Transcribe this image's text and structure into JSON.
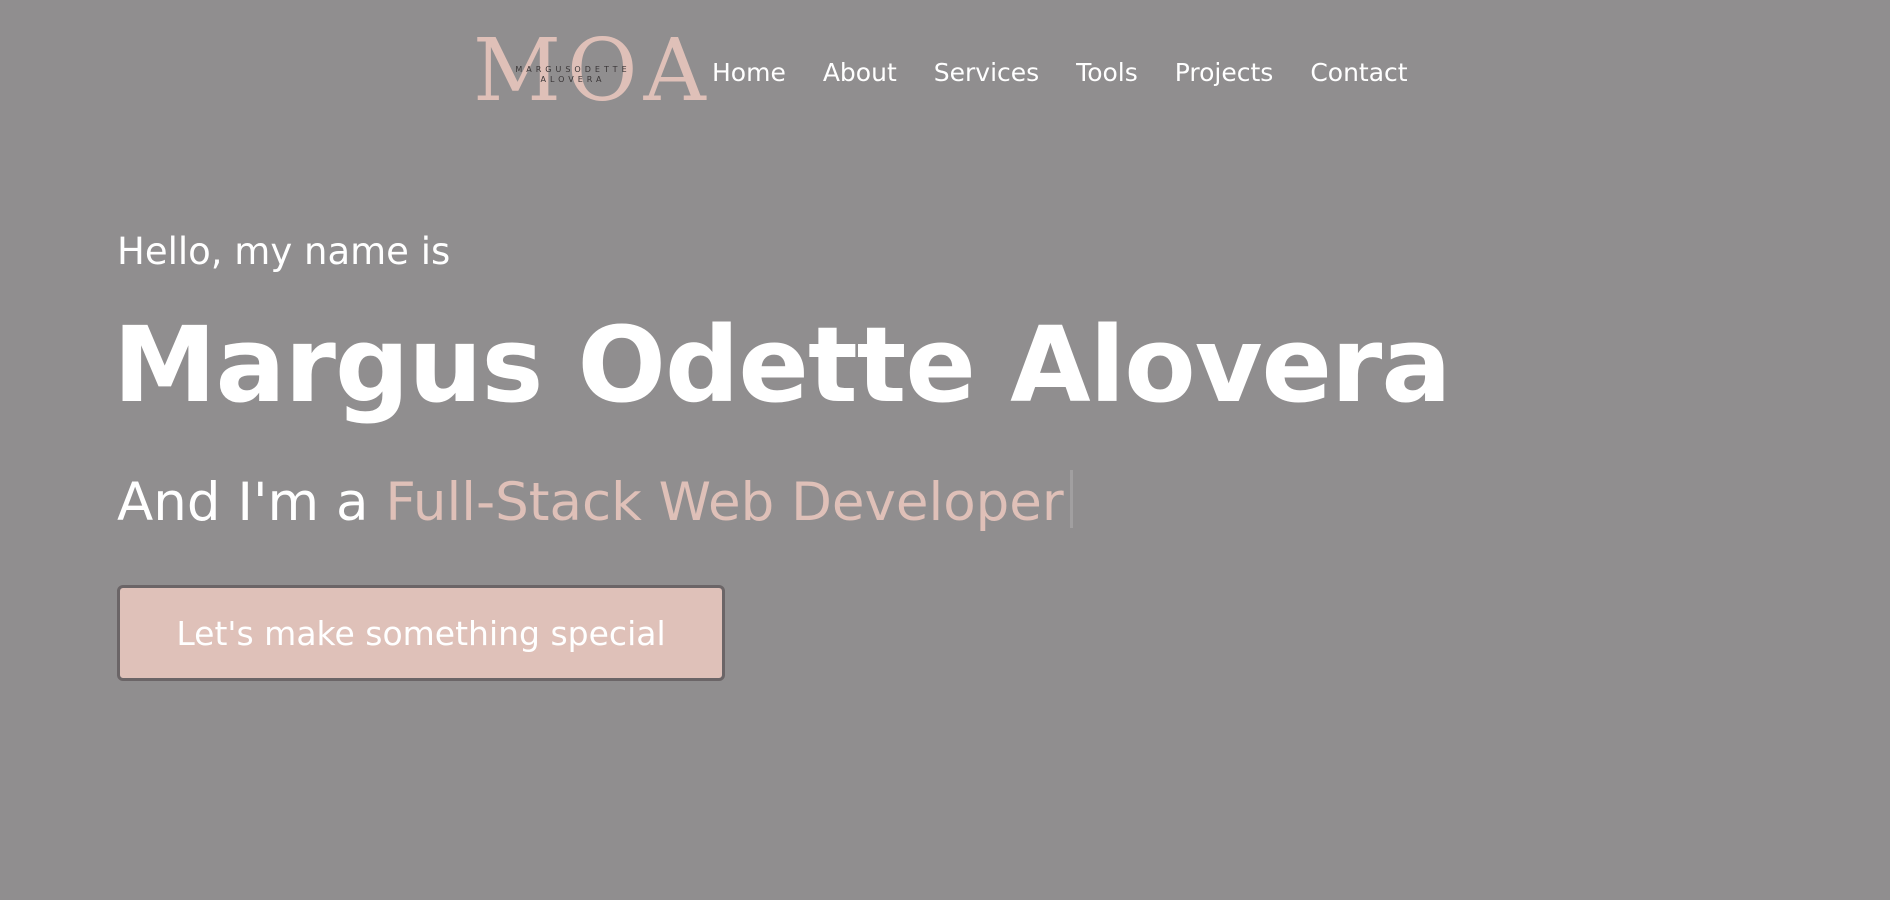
{
  "logo": {
    "letters": "MOA",
    "line1": "MARGUSODETTE",
    "line2": "ALOVERA"
  },
  "nav": {
    "items": [
      {
        "label": "Home"
      },
      {
        "label": "About"
      },
      {
        "label": "Services"
      },
      {
        "label": "Tools"
      },
      {
        "label": "Projects"
      },
      {
        "label": "Contact"
      }
    ]
  },
  "hero": {
    "intro": "Hello, my name is",
    "name": "Margus Odette Alovera",
    "role_prefix": "And I'm a ",
    "role_highlight": "Full-Stack Web Developer",
    "cta_label": "Let's make something special"
  },
  "colors": {
    "background": "#908e8f",
    "accent": "#dfc0b8",
    "text": "#ffffff"
  }
}
